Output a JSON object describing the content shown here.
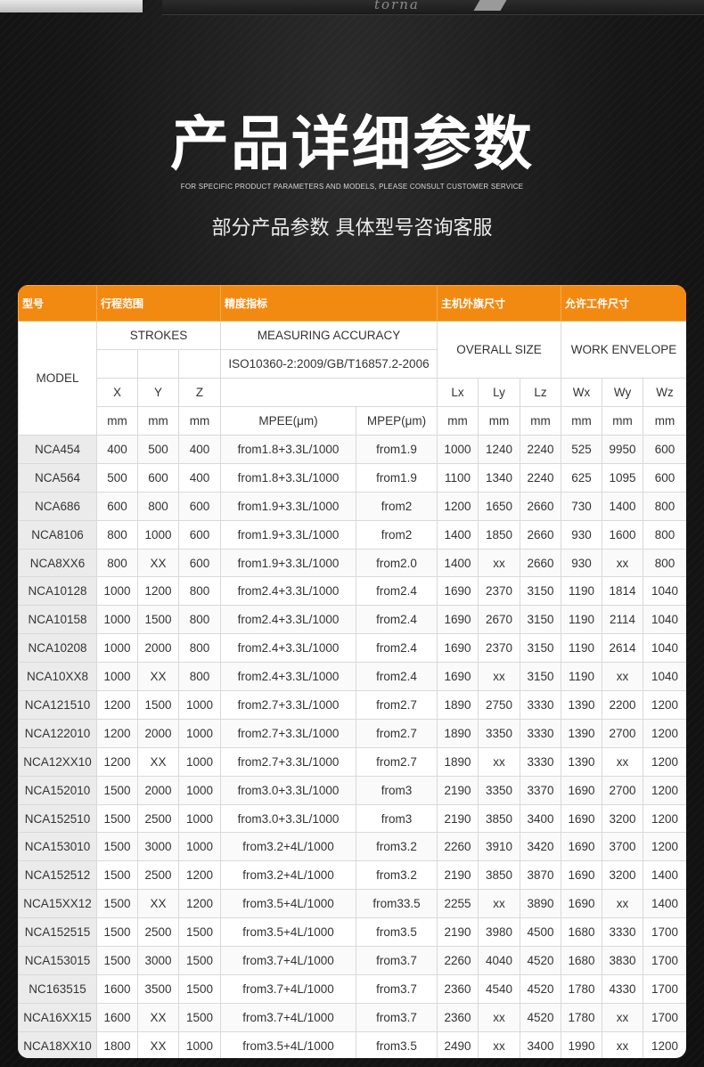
{
  "header": {
    "top_engraving": "torna",
    "title": "产品详细参数",
    "subtitle_en": "FOR SPECIFIC PRODUCT PARAMETERS AND MODELS, PLEASE CONSULT CUSTOMER SERVICE",
    "subtitle_cn": "部分产品参数 具体型号咨询客服"
  },
  "colors": {
    "accent": "#f28a12",
    "background": "#151515",
    "row_gray": "#ebebeb"
  },
  "table": {
    "groups": [
      "型号",
      "行程范围",
      "精度指标",
      "主机外旗尺寸",
      "允许工件尺寸"
    ],
    "model_label": "MODEL",
    "strokes_label": "STROKES",
    "accuracy_label": "MEASURING ACCURACY",
    "accuracy_standard": "ISO10360-2:2009/GB/T16857.2-2006",
    "overall_label": "OVERALL SIZE",
    "work_label": "WORK ENVELOPE",
    "axes": [
      "X",
      "Y",
      "Z",
      "Lx",
      "Ly",
      "Lz",
      "Wx",
      "Wy",
      "Wz"
    ],
    "units": [
      "mm",
      "mm",
      "mm",
      "MPEE(μm)",
      "MPEP(μm)",
      "mm",
      "mm",
      "mm",
      "mm",
      "mm",
      "mm"
    ],
    "rows": [
      [
        "NCA454",
        "400",
        "500",
        "400",
        "from1.8+3.3L/1000",
        "from1.9",
        "1000",
        "1240",
        "2240",
        "525",
        "9950",
        "600"
      ],
      [
        "NCA564",
        "500",
        "600",
        "400",
        "from1.8+3.3L/1000",
        "from1.9",
        "1100",
        "1340",
        "2240",
        "625",
        "1095",
        "600"
      ],
      [
        "NCA686",
        "600",
        "800",
        "600",
        "from1.9+3.3L/1000",
        "from2",
        "1200",
        "1650",
        "2660",
        "730",
        "1400",
        "800"
      ],
      [
        "NCA8106",
        "800",
        "1000",
        "600",
        "from1.9+3.3L/1000",
        "from2",
        "1400",
        "1850",
        "2660",
        "930",
        "1600",
        "800"
      ],
      [
        "NCA8XX6",
        "800",
        "XX",
        "600",
        "from1.9+3.3L/1000",
        "from2.0",
        "1400",
        "xx",
        "2660",
        "930",
        "xx",
        "800"
      ],
      [
        "NCA10128",
        "1000",
        "1200",
        "800",
        "from2.4+3.3L/1000",
        "from2.4",
        "1690",
        "2370",
        "3150",
        "1190",
        "1814",
        "1040"
      ],
      [
        "NCA10158",
        "1000",
        "1500",
        "800",
        "from2.4+3.3L/1000",
        "from2.4",
        "1690",
        "2670",
        "3150",
        "1190",
        "2114",
        "1040"
      ],
      [
        "NCA10208",
        "1000",
        "2000",
        "800",
        "from2.4+3.3L/1000",
        "from2.4",
        "1690",
        "2370",
        "3150",
        "1190",
        "2614",
        "1040"
      ],
      [
        "NCA10XX8",
        "1000",
        "XX",
        "800",
        "from2.4+3.3L/1000",
        "from2.4",
        "1690",
        "xx",
        "3150",
        "1190",
        "xx",
        "1040"
      ],
      [
        "NCA121510",
        "1200",
        "1500",
        "1000",
        "from2.7+3.3L/1000",
        "from2.7",
        "1890",
        "2750",
        "3330",
        "1390",
        "2200",
        "1200"
      ],
      [
        "NCA122010",
        "1200",
        "2000",
        "1000",
        "from2.7+3.3L/1000",
        "from2.7",
        "1890",
        "3350",
        "3330",
        "1390",
        "2700",
        "1200"
      ],
      [
        "NCA12XX10",
        "1200",
        "XX",
        "1000",
        "from2.7+3.3L/1000",
        "from2.7",
        "1890",
        "xx",
        "3330",
        "1390",
        "xx",
        "1200"
      ],
      [
        "NCA152010",
        "1500",
        "2000",
        "1000",
        "from3.0+3.3L/1000",
        "from3",
        "2190",
        "3350",
        "3370",
        "1690",
        "2700",
        "1200"
      ],
      [
        "NCA152510",
        "1500",
        "2500",
        "1000",
        "from3.0+3.3L/1000",
        "from3",
        "2190",
        "3850",
        "3400",
        "1690",
        "3200",
        "1200"
      ],
      [
        "NCA153010",
        "1500",
        "3000",
        "1000",
        "from3.2+4L/1000",
        "from3.2",
        "2260",
        "3910",
        "3420",
        "1690",
        "3700",
        "1200"
      ],
      [
        "NCA152512",
        "1500",
        "2500",
        "1200",
        "from3.2+4L/1000",
        "from3.2",
        "2190",
        "3850",
        "3870",
        "1690",
        "3200",
        "1400"
      ],
      [
        "NCA15XX12",
        "1500",
        "XX",
        "1200",
        "from3.5+4L/1000",
        "from33.5",
        "2255",
        "xx",
        "3890",
        "1690",
        "xx",
        "1400"
      ],
      [
        "NCA152515",
        "1500",
        "2500",
        "1500",
        "from3.5+4L/1000",
        "from3.5",
        "2190",
        "3980",
        "4500",
        "1680",
        "3330",
        "1700"
      ],
      [
        "NCA153015",
        "1500",
        "3000",
        "1500",
        "from3.7+4L/1000",
        "from3.7",
        "2260",
        "4040",
        "4520",
        "1680",
        "3830",
        "1700"
      ],
      [
        "NC163515",
        "1600",
        "3500",
        "1500",
        "from3.7+4L/1000",
        "from3.7",
        "2360",
        "4540",
        "4520",
        "1780",
        "4330",
        "1700"
      ],
      [
        "NCA16XX15",
        "1600",
        "XX",
        "1500",
        "from3.7+4L/1000",
        "from3.7",
        "2360",
        "xx",
        "4520",
        "1780",
        "xx",
        "1700"
      ],
      [
        "NCA18XX10",
        "1800",
        "XX",
        "1000",
        "from3.5+4L/1000",
        "from3.5",
        "2490",
        "xx",
        "3400",
        "1990",
        "xx",
        "1200"
      ]
    ]
  }
}
